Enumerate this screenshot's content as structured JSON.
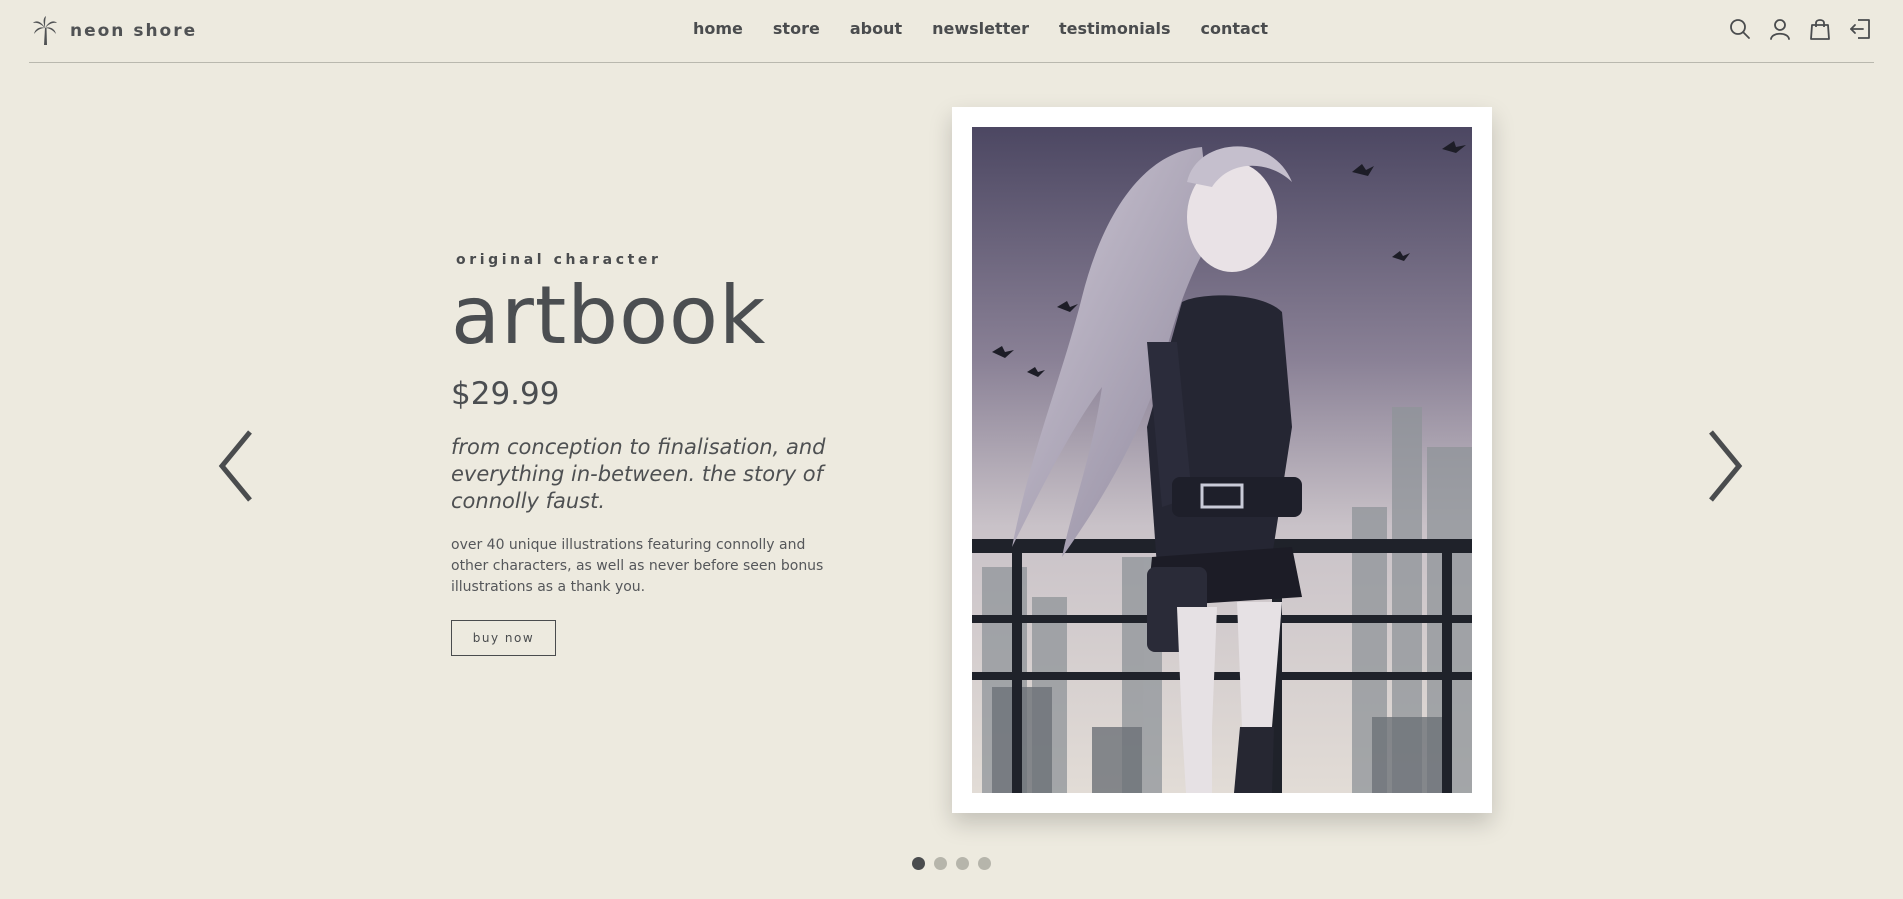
{
  "brand": {
    "name": "neon shore",
    "logo_icon": "palm-tree-icon"
  },
  "nav": {
    "items": [
      {
        "label": "home"
      },
      {
        "label": "store"
      },
      {
        "label": "about"
      },
      {
        "label": "newsletter"
      },
      {
        "label": "testimonials"
      },
      {
        "label": "contact"
      }
    ]
  },
  "header_icons": [
    "search-icon",
    "user-icon",
    "shopping-bag-icon",
    "sign-out-icon"
  ],
  "hero": {
    "eyebrow": "original character",
    "title": "artbook",
    "price": "$29.99",
    "tagline": "from conception to finalisation, and everything in-between. the story of connolly faust.",
    "description": "over 40 unique illustrations featuring connolly and other characters, as well as never before seen bonus illustrations as a thank you.",
    "cta_label": "buy now"
  },
  "carousel": {
    "slide_count": 4,
    "active_index": 0,
    "prev_icon": "chevron-left-icon",
    "next_icon": "chevron-right-icon"
  },
  "colors": {
    "background": "#edeadf",
    "text": "#4a4c4e",
    "rule": "#b9b8ae",
    "dot_inactive": "#b6b5ab",
    "frame": "#ffffff"
  }
}
